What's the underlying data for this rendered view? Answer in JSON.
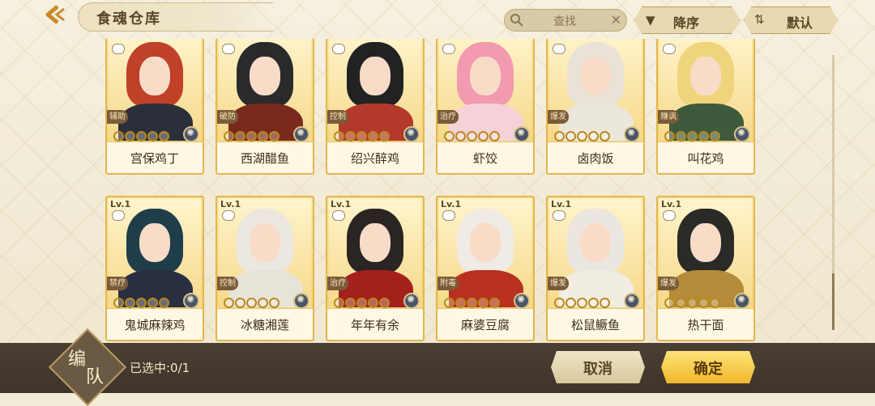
{
  "header": {
    "title": "食魂仓库",
    "search_placeholder": "查找",
    "sort_label": "降序",
    "default_label": "默认"
  },
  "cards": [
    {
      "level": "",
      "role": "辅助",
      "name": "宫保鸡丁",
      "stars": 0,
      "hair": "#c0402a",
      "outfit": "#2b2f3a"
    },
    {
      "level": "",
      "role": "破防",
      "name": "西湖醋鱼",
      "stars": 0,
      "hair": "#2a2a2a",
      "outfit": "#7a2a1c"
    },
    {
      "level": "",
      "role": "控制",
      "name": "绍兴醉鸡",
      "stars": 0,
      "hair": "#222222",
      "outfit": "#b33a2a"
    },
    {
      "level": "",
      "role": "治疗",
      "name": "虾饺",
      "stars": 0,
      "hair": "#f19ab0",
      "outfit": "#f6d2d8"
    },
    {
      "level": "",
      "role": "爆发",
      "name": "卤肉饭",
      "stars": 0,
      "hair": "#e8e3d6",
      "outfit": "#ece7db"
    },
    {
      "level": "",
      "role": "赚讽",
      "name": "叫花鸡",
      "stars": 0,
      "hair": "#f0d47c",
      "outfit": "#3e5a3c"
    },
    {
      "level": "Lv.1",
      "role": "禁疗",
      "name": "鬼城麻辣鸡",
      "stars": 0,
      "hair": "#1f3d4a",
      "outfit": "#2a2f40"
    },
    {
      "level": "Lv.1",
      "role": "控制",
      "name": "冰糖湘莲",
      "stars": 0,
      "hair": "#ece8e0",
      "outfit": "#e8e3d8"
    },
    {
      "level": "Lv.1",
      "role": "治疗",
      "name": "年年有余",
      "stars": 0,
      "hair": "#2a2422",
      "outfit": "#a4201c"
    },
    {
      "level": "Lv.1",
      "role": "附毒",
      "name": "麻婆豆腐",
      "stars": 0,
      "hair": "#f0ebe4",
      "outfit": "#b83020"
    },
    {
      "level": "Lv.1",
      "role": "爆发",
      "name": "松鼠鳜鱼",
      "stars": 0,
      "hair": "#ebe6df",
      "outfit": "#f1ede3"
    },
    {
      "level": "Lv.1",
      "role": "爆发",
      "name": "热干面",
      "stars": 0,
      "hair": "#2a2a26",
      "outfit": "#b58b3a"
    }
  ],
  "footer": {
    "team_label_1": "编",
    "team_label_2": "队",
    "selected_text": "已选中:0/1",
    "cancel_label": "取消",
    "confirm_label": "确定"
  }
}
